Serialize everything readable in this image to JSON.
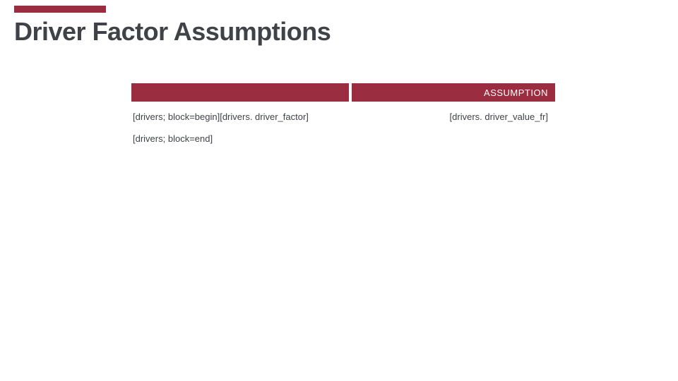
{
  "title": "Driver Factor Assumptions",
  "table": {
    "header_left": "",
    "header_right": "ASSUMPTION",
    "rows": [
      {
        "left": "[drivers; block=begin][drivers. driver_factor]",
        "right": "[drivers. driver_value_fr]"
      }
    ],
    "block_end": "[drivers; block=end]"
  },
  "colors": {
    "accent": "#9a2e40",
    "text": "#404248"
  }
}
